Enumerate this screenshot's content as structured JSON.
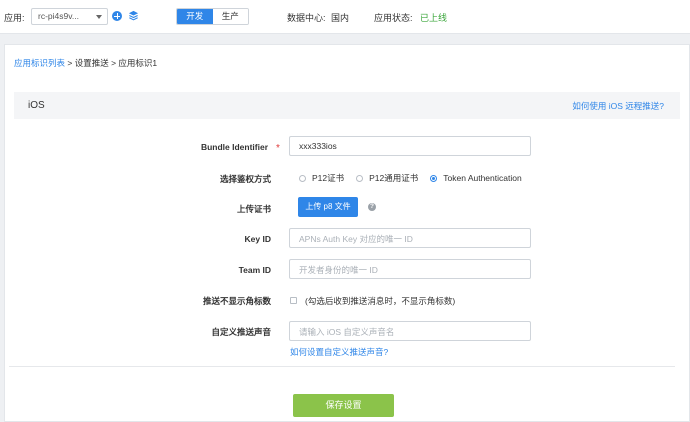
{
  "topbar": {
    "app_label": "应用:",
    "app_value": "rc-pi4s9v...",
    "env_dev": "开发",
    "env_prod": "生产",
    "datacenter_label": "数据中心:",
    "datacenter_value": "国内",
    "status_label": "应用状态:",
    "status_value": "已上线"
  },
  "breadcrumb": {
    "link": "应用标识列表",
    "sep1": " > ",
    "item2": "设置推送",
    "sep2": " > ",
    "item3": "应用标识1"
  },
  "section": {
    "title": "iOS",
    "help_link": "如何使用 iOS 远程推送?"
  },
  "form": {
    "bundle_label": "Bundle Identifier",
    "bundle_value": "xxx333ios",
    "auth_label": "选择鉴权方式",
    "auth_options": [
      "P12证书",
      "P12通用证书",
      "Token Authentication"
    ],
    "auth_selected": "Token Authentication",
    "cert_label": "上传证书",
    "upload_button": "上传 p8 文件",
    "help_icon": "?",
    "keyid_label": "Key ID",
    "keyid_placeholder": "APNs Auth Key 对应的唯一 ID",
    "teamid_label": "Team ID",
    "teamid_placeholder": "开发者身份的唯一 ID",
    "badge_label": "推送不显示角标数",
    "badge_checkbox_text": "(勾选后收到推送消息时，不显示角标数)",
    "badge_checked": false,
    "sound_label": "自定义推送声音",
    "sound_placeholder": "请输入 iOS 自定义声音名",
    "sound_help_link": "如何设置自定义推送声音?",
    "save_button": "保存设置"
  },
  "colors": {
    "accent": "#2f86e8",
    "save_green": "#8bc34a",
    "status_green": "#3aa53a",
    "required_red": "#e03b3b"
  },
  "icons": [
    "add-icon",
    "layers-icon",
    "caret-down-icon",
    "question-icon"
  ]
}
